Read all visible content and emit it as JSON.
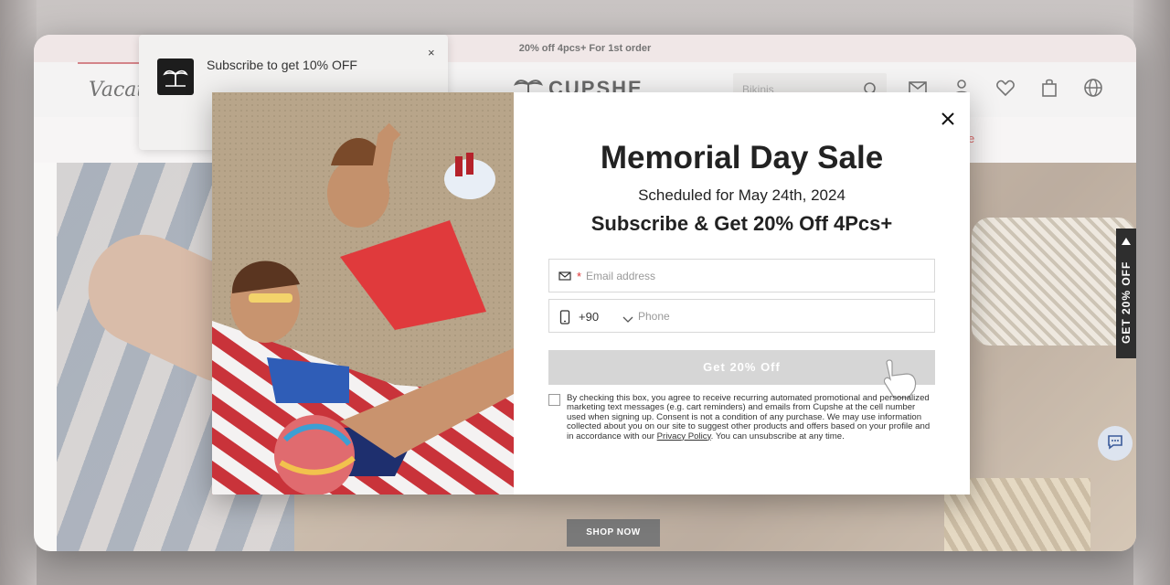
{
  "promo_bar": {
    "text": "20% off 4pcs+ For 1st order"
  },
  "header": {
    "vacation_text": "Vacat",
    "logo_text": "CUPSHE",
    "search_placeholder": "Bikinis"
  },
  "nav": {
    "sale_fragment": "e"
  },
  "hero": {
    "shop_now": "SHOP NOW"
  },
  "side_tab": {
    "label": "GET 20% OFF"
  },
  "subscribe_popup": {
    "text": "Subscribe to get 10% OFF",
    "close": "×"
  },
  "modal": {
    "title": "Memorial Day Sale",
    "scheduled": "Scheduled for May 24th, 2024",
    "subtitle": "Subscribe & Get 20% Off 4Pcs+",
    "email": {
      "required_mark": "*",
      "placeholder": "Email address"
    },
    "phone": {
      "country_code": "+90",
      "placeholder": "Phone"
    },
    "cta": "Get 20% Off",
    "legal_pre": "By checking this box, you agree to receive recurring automated promotional and personalized marketing text messages (e.g. cart reminders) and emails from Cupshe at the cell number used when signing up. Consent is not a condition of any purchase. We may use information collected about you on our site to suggest other products and offers based on your profile and in accordance with our ",
    "legal_link": "Privacy Policy",
    "legal_post": ". You can unsubscribe at any time."
  },
  "colors": {
    "promo_bg": "#e9dcdc",
    "cta_disabled": "#d6d6d6",
    "required": "#dd3333",
    "side_tab_bg": "#2e2e2e"
  },
  "icons": [
    "palm-logo-icon",
    "search-icon",
    "mail-icon",
    "account-icon",
    "heart-icon",
    "bag-icon",
    "globe-icon",
    "chat-icon",
    "close-icon",
    "envelope-icon",
    "phone-device-icon",
    "chevron-down-icon",
    "pointer-hand-icon"
  ]
}
